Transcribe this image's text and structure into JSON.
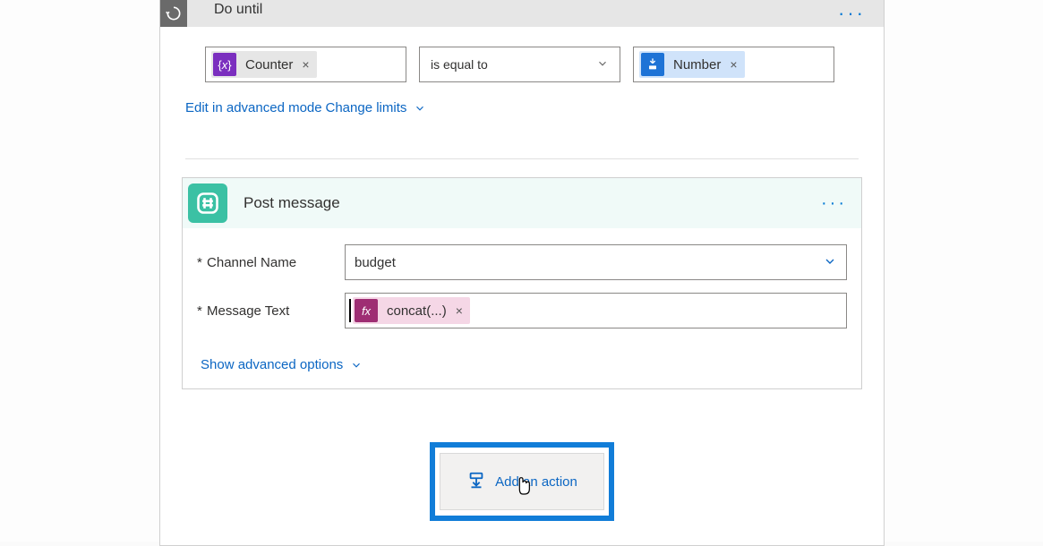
{
  "do_until": {
    "title": "Do until",
    "left_token": {
      "label": "Counter"
    },
    "operator": "is equal to",
    "right_token": {
      "label": "Number"
    },
    "edit_advanced": "Edit in advanced mode",
    "change_limits": "Change limits"
  },
  "post_message": {
    "title": "Post message",
    "channel_label": "Channel Name",
    "channel_value": "budget",
    "message_label": "Message Text",
    "message_token": "concat(...)",
    "show_advanced": "Show advanced options"
  },
  "add_action": {
    "label": "Add an action"
  },
  "icons": {
    "do_until": "do-until-icon",
    "variable": "variable-icon",
    "number": "number-icon",
    "slack": "slack-hash-icon",
    "fx": "fx-icon",
    "insert": "insert-action-icon"
  }
}
